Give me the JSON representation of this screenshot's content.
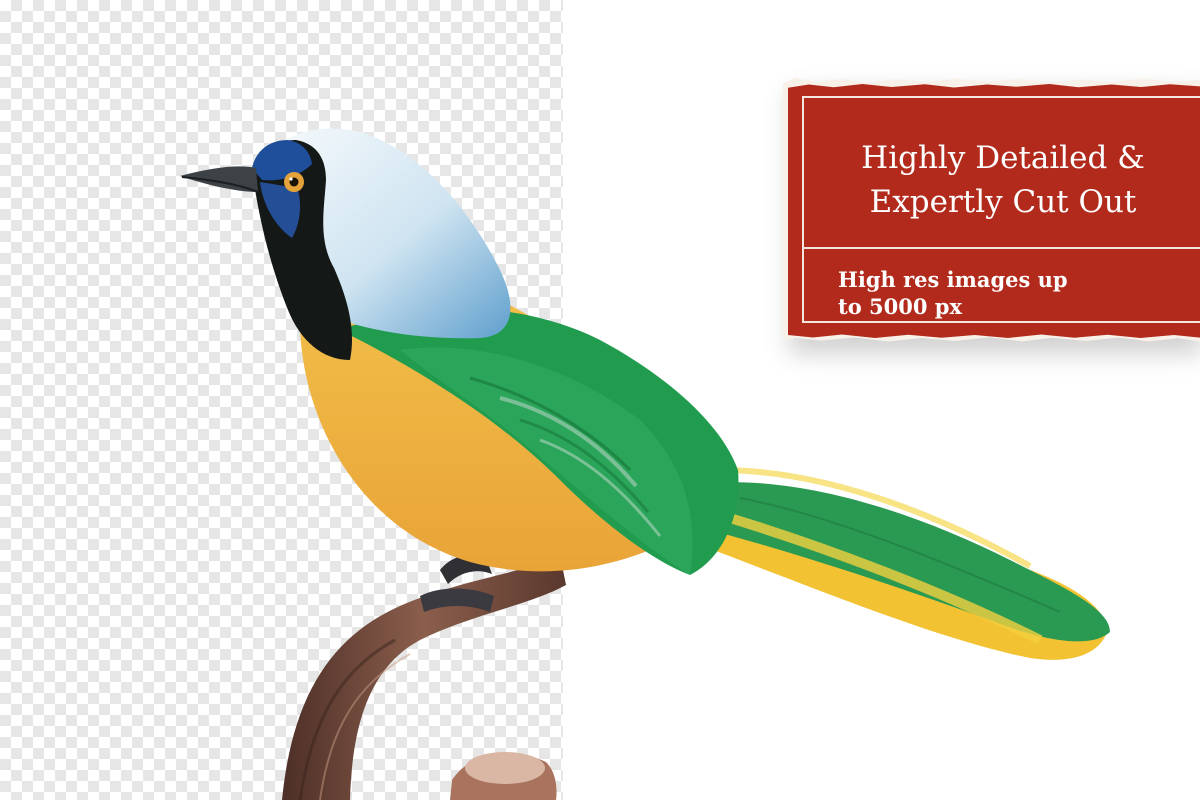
{
  "badge": {
    "headline_line1": "Highly Detailed &",
    "headline_line2": "Expertly Cut Out",
    "subline_line1": "High res images up",
    "subline_line2": "to 5000 px"
  },
  "colors": {
    "badge_red": "#b22a1c",
    "badge_text": "#ffffff",
    "checker_light": "#ffffff",
    "checker_dark": "#e6e6e6",
    "bird_green": "#1f8a46",
    "bird_yellow": "#f0be2a",
    "bird_blue": "#4f98c8",
    "branch_brown": "#6e4636"
  }
}
